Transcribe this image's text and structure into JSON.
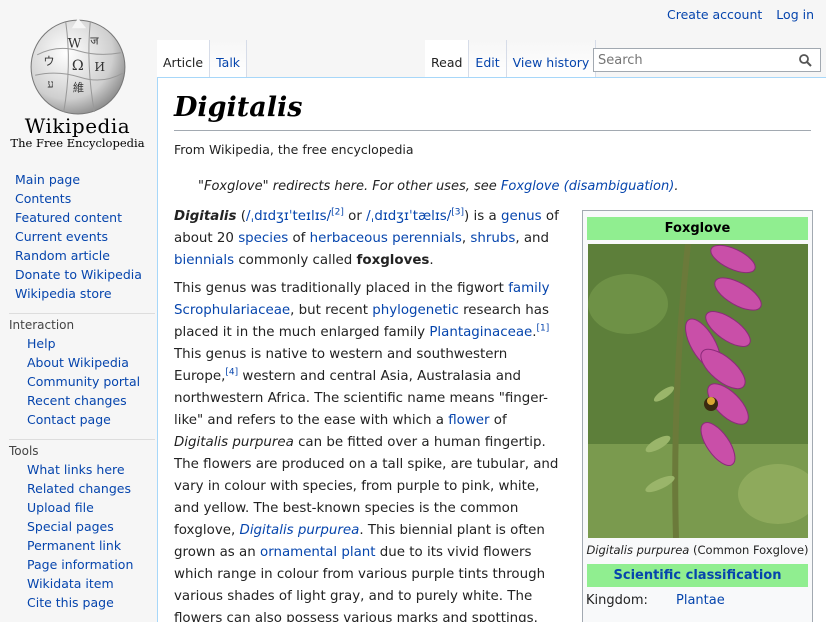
{
  "logo": {
    "wordmark": "Wikipedia",
    "tagline": "The Free Encyclopedia"
  },
  "personal": {
    "create_account": "Create account",
    "login": "Log in"
  },
  "nav": [
    "Main page",
    "Contents",
    "Featured content",
    "Current events",
    "Random article",
    "Donate to Wikipedia",
    "Wikipedia store"
  ],
  "interaction": {
    "heading": "Interaction",
    "items": [
      "Help",
      "About Wikipedia",
      "Community portal",
      "Recent changes",
      "Contact page"
    ]
  },
  "tools": {
    "heading": "Tools",
    "items": [
      "What links here",
      "Related changes",
      "Upload file",
      "Special pages",
      "Permanent link",
      "Page information",
      "Wikidata item",
      "Cite this page"
    ]
  },
  "tabs": {
    "article": "Article",
    "talk": "Talk",
    "read": "Read",
    "edit": "Edit",
    "history": "View history"
  },
  "search": {
    "placeholder": "Search"
  },
  "page": {
    "title": "Digitalis",
    "tagline": "From Wikipedia, the free encyclopedia",
    "hatnote": {
      "pre": "\"Foxglove\" redirects here. For other uses, see ",
      "link": "Foxglove (disambiguation)",
      "post": "."
    }
  },
  "infobox": {
    "title": "Foxglove",
    "caption_italic": "Digitalis purpurea",
    "caption_rest": " (Common Foxglove)",
    "sci_heading": "Scientific classification",
    "kingdom_label": "Kingdom:",
    "kingdom_value": "Plantae"
  },
  "colors": {
    "link": "#0645ad",
    "infobox_header": "#90ee90",
    "border": "#a7d7f9"
  }
}
